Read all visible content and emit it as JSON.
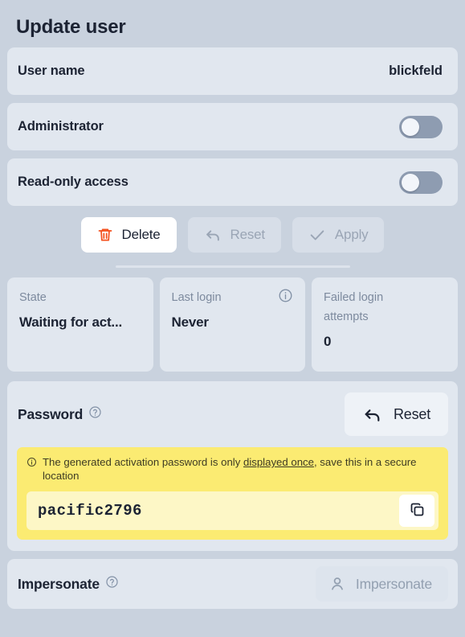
{
  "header": {
    "title": "Update user"
  },
  "user_name_row": {
    "label": "User name",
    "value": "blickfeld"
  },
  "toggles": [
    {
      "label": "Administrator",
      "state": "off"
    },
    {
      "label": "Read-only access",
      "state": "off"
    }
  ],
  "actions": {
    "delete_label": "Delete",
    "reset_label": "Reset",
    "apply_label": "Apply",
    "delete_icon": "trash-icon",
    "reset_icon": "undo-arrow-icon",
    "apply_icon": "check-icon",
    "delete_icon_color": "#f4511e"
  },
  "stats": [
    {
      "label": "State",
      "value": "Waiting for act...",
      "icon": ""
    },
    {
      "label": "Last login",
      "value": "Never",
      "icon": "info-icon"
    },
    {
      "label": "Failed login attempts",
      "value": "0",
      "icon": ""
    }
  ],
  "password": {
    "title": "Password",
    "help_icon": "help-circle-icon",
    "reset_label": "Reset",
    "reset_icon": "undo-arrow-icon",
    "warning_prefix": "The generated activation password is only ",
    "warning_underlined": "displayed once",
    "warning_suffix": ", save this in a secure location",
    "warning_icon": "info-icon",
    "value": "pacific2796",
    "copy_icon": "copy-icon"
  },
  "impersonate": {
    "title": "Impersonate",
    "help_icon": "help-circle-icon",
    "button_label": "Impersonate",
    "button_icon": "user-icon"
  },
  "colors": {
    "page_background": "#c9d2de",
    "card_background": "#e1e7ef",
    "text_primary": "#1c2333",
    "text_muted": "#7d8a9e",
    "danger": "#f4511e",
    "warning_banner": "#fbeb72",
    "warning_field": "#fdf7c6",
    "toggle_track": "#8e9cb1"
  }
}
